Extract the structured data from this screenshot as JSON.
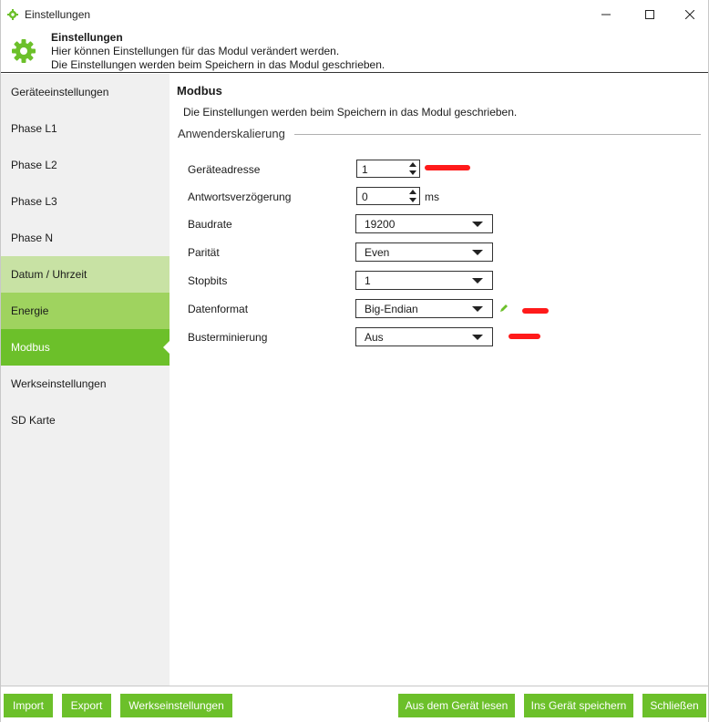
{
  "window": {
    "title": "Einstellungen"
  },
  "header": {
    "title": "Einstellungen",
    "line1": "Hier können Einstellungen für das Modul verändert werden.",
    "line2": "Die Einstellungen werden beim Speichern in das Modul geschrieben."
  },
  "sidebar": {
    "items": [
      {
        "label": "Geräteeinstellungen"
      },
      {
        "label": "Phase L1"
      },
      {
        "label": "Phase L2"
      },
      {
        "label": "Phase L3"
      },
      {
        "label": "Phase N"
      },
      {
        "label": "Datum / Uhrzeit"
      },
      {
        "label": "Energie"
      },
      {
        "label": "Modbus",
        "selected": true
      },
      {
        "label": "Werkseinstellungen"
      },
      {
        "label": "SD Karte"
      }
    ]
  },
  "content": {
    "title": "Modbus",
    "description": "Die Einstellungen werden beim Speichern in das Modul geschrieben.",
    "group": "Anwenderskalierung",
    "fields": {
      "address": {
        "label": "Geräteadresse",
        "value": "1"
      },
      "delay": {
        "label": "Antwortsverzögerung",
        "value": "0",
        "unit": "ms"
      },
      "baud": {
        "label": "Baudrate",
        "value": "19200"
      },
      "parity": {
        "label": "Parität",
        "value": "Even"
      },
      "stopbits": {
        "label": "Stopbits",
        "value": "1"
      },
      "format": {
        "label": "Datenformat",
        "value": "Big-Endian"
      },
      "termination": {
        "label": "Busterminierung",
        "value": "Aus"
      }
    }
  },
  "footer": {
    "import": "Import",
    "export": "Export",
    "factory": "Werkseinstellungen",
    "read": "Aus dem Gerät lesen",
    "save": "Ins Gerät speichern",
    "close": "Schließen"
  },
  "colors": {
    "accent": "#6cc02a",
    "accent_mid": "#9fd35f",
    "accent_light": "#c8e2a4",
    "redaction": "#ff1a1a"
  }
}
